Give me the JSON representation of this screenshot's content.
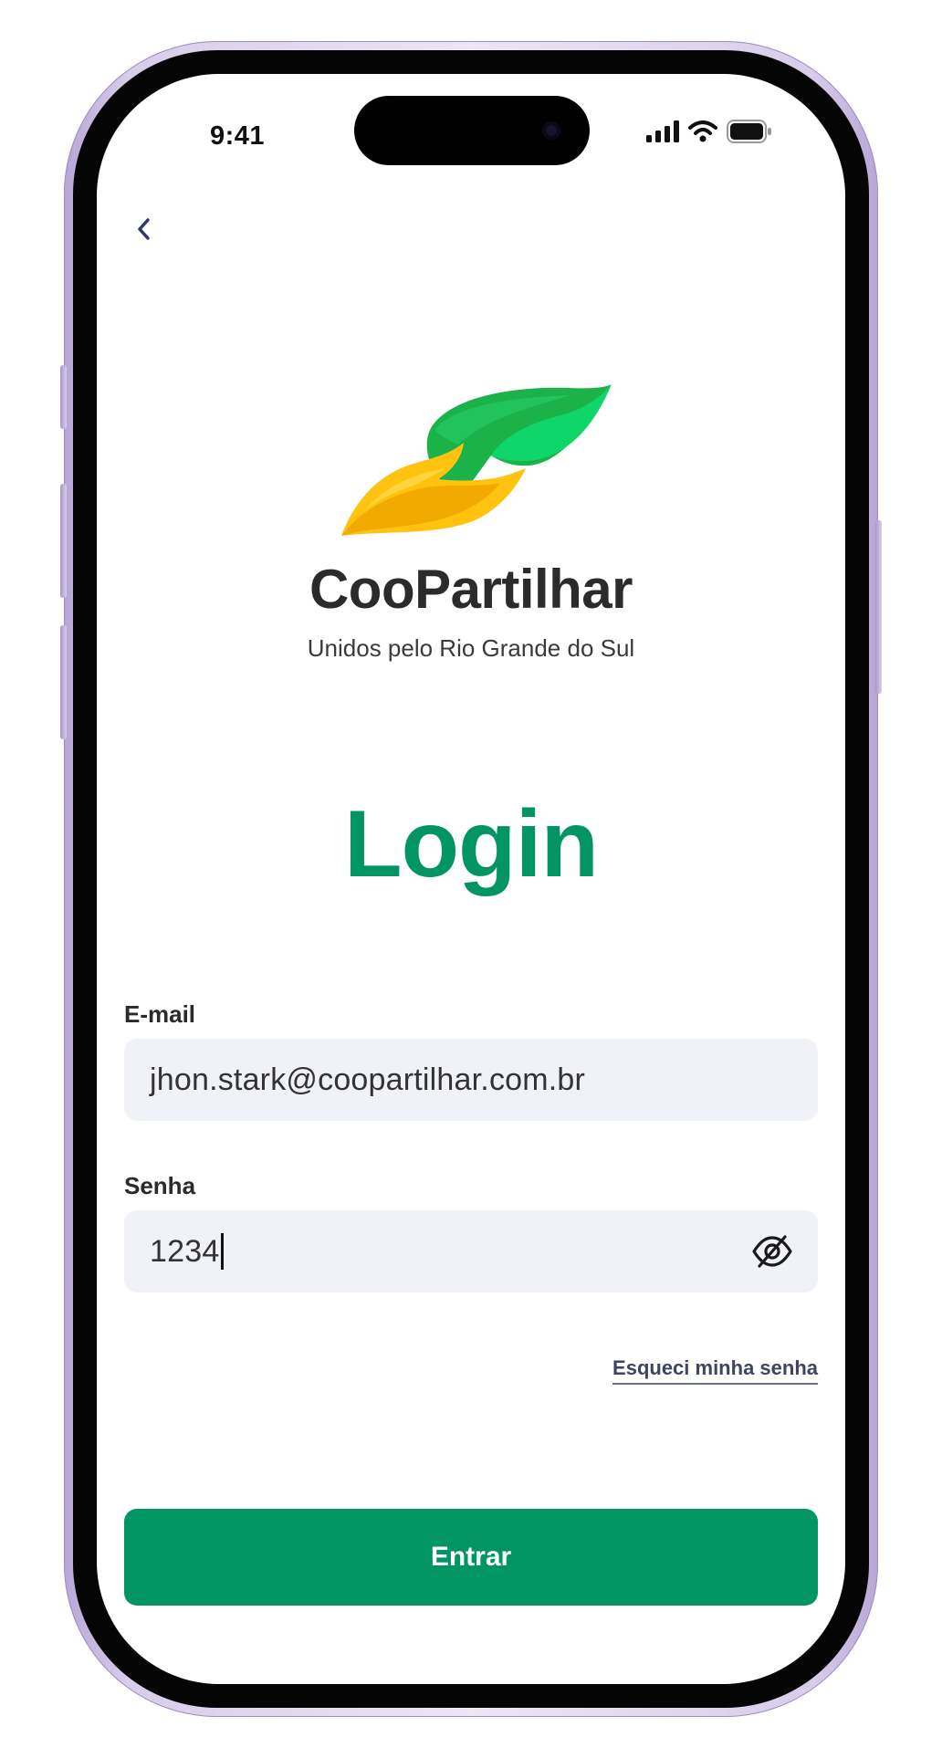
{
  "status_bar": {
    "time": "9:41"
  },
  "brand": {
    "name": "CooPartilhar",
    "tagline": "Unidos pelo Rio Grande do Sul",
    "colors": {
      "primary": "#009562",
      "leaf_green": "#1bb24a",
      "leaf_yellow": "#ffc20e"
    }
  },
  "page": {
    "title": "Login"
  },
  "form": {
    "email": {
      "label": "E-mail",
      "value": "jhon.stark@coopartilhar.com.br"
    },
    "password": {
      "label": "Senha",
      "value": "1234",
      "toggle_icon": "eye-off-icon"
    },
    "forgot_label": "Esqueci minha senha",
    "submit_label": "Entrar"
  },
  "icons": {
    "back": "chevron-left-icon",
    "signal": "cellular-signal-icon",
    "wifi": "wifi-icon",
    "battery": "battery-icon"
  }
}
